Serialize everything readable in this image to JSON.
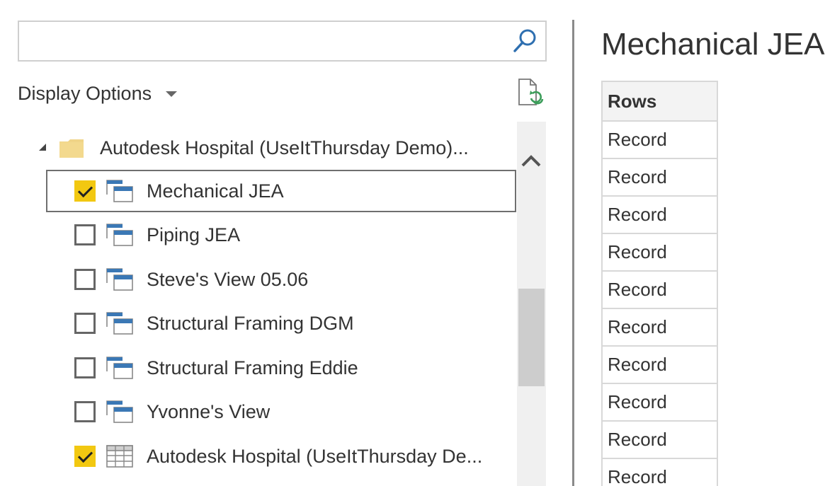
{
  "search": {
    "value": "",
    "placeholder": ""
  },
  "display_options": {
    "label": "Display Options"
  },
  "tree": {
    "folder": {
      "label": "Autodesk Hospital (UseItThursday Demo)..."
    },
    "items": [
      {
        "label": "Mechanical JEA",
        "checked": true,
        "selected": true,
        "icon": "view-icon"
      },
      {
        "label": "Piping JEA",
        "checked": false,
        "selected": false,
        "icon": "view-icon"
      },
      {
        "label": "Steve's View 05.06",
        "checked": false,
        "selected": false,
        "icon": "view-icon"
      },
      {
        "label": "Structural Framing DGM",
        "checked": false,
        "selected": false,
        "icon": "view-icon"
      },
      {
        "label": "Structural Framing Eddie",
        "checked": false,
        "selected": false,
        "icon": "view-icon"
      },
      {
        "label": "Yvonne's View",
        "checked": false,
        "selected": false,
        "icon": "view-icon"
      },
      {
        "label": "Autodesk Hospital (UseItThursday De...",
        "checked": true,
        "selected": false,
        "icon": "table-icon"
      }
    ]
  },
  "preview": {
    "title": "Mechanical JEA",
    "column_header": "Rows",
    "rows": [
      "Record",
      "Record",
      "Record",
      "Record",
      "Record",
      "Record",
      "Record",
      "Record",
      "Record",
      "Record"
    ]
  },
  "colors": {
    "checkbox_checked": "#f2c811",
    "icon_blue": "#3b78b5",
    "folder": "#f0d487"
  }
}
